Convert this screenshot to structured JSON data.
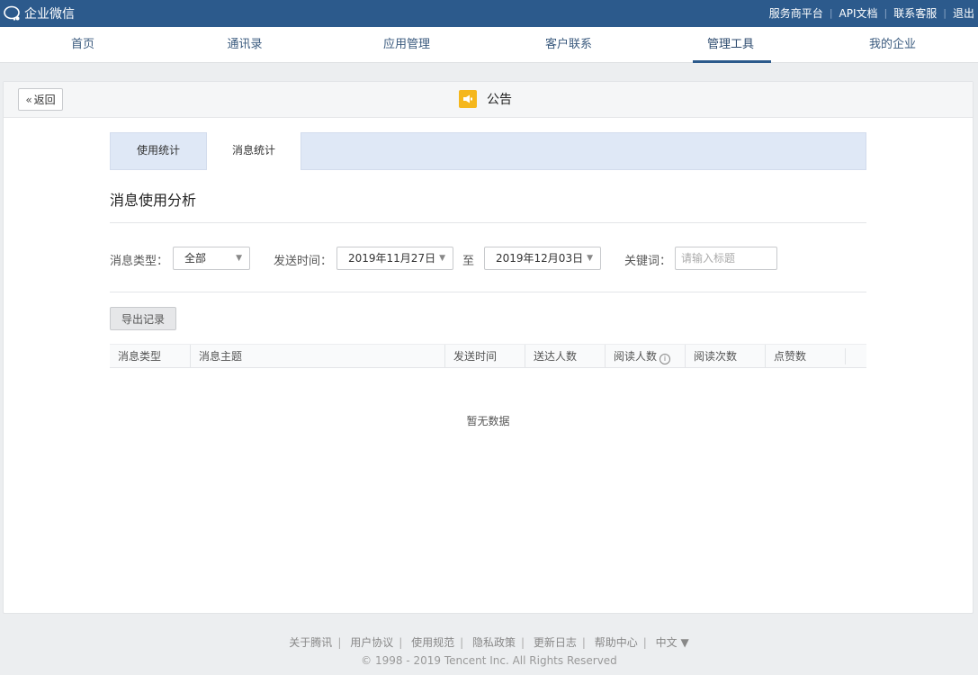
{
  "app": {
    "title": "企业微信"
  },
  "topbar": {
    "links": [
      "服务商平台",
      "API文档",
      "联系客服",
      "退出"
    ]
  },
  "nav": {
    "items": [
      "首页",
      "通讯录",
      "应用管理",
      "客户联系",
      "管理工具",
      "我的企业"
    ],
    "active": "管理工具"
  },
  "header": {
    "back_label": "返回",
    "title": "公告"
  },
  "tabs": [
    "使用统计",
    "消息统计"
  ],
  "section": {
    "title": "消息使用分析"
  },
  "filters": {
    "type_label": "消息类型：",
    "type_value": "全部",
    "time_label": "发送时间：",
    "start_date": "2019年11月27日",
    "to_label": "至",
    "end_date": "2019年12月03日",
    "keyword_label": "关键词：",
    "keyword_placeholder": "请输入标题",
    "keyword_value": ""
  },
  "export_label": "导出记录",
  "table": {
    "columns": [
      "消息类型",
      "消息主题",
      "发送时间",
      "送达人数",
      "阅读人数",
      "阅读次数",
      "点赞数"
    ],
    "empty_text": "暂无数据"
  },
  "footer": {
    "links": [
      "关于腾讯",
      "用户协议",
      "使用规范",
      "隐私政策",
      "更新日志",
      "帮助中心",
      "中文 ▼"
    ],
    "copyright": "© 1998 - 2019 Tencent Inc. All Rights Reserved"
  },
  "colors": {
    "topbar": "#2c5a8c",
    "accent": "#2c5a8c",
    "announce_icon": "#f5b71c",
    "tab_bar": "#dfe8f6"
  },
  "icons": {
    "logo": "wechat-work-logo-icon",
    "back": "double-chevron-left-icon",
    "announce": "announcement-icon",
    "dropdown": "caret-down-icon",
    "info": "info-circle-icon"
  }
}
